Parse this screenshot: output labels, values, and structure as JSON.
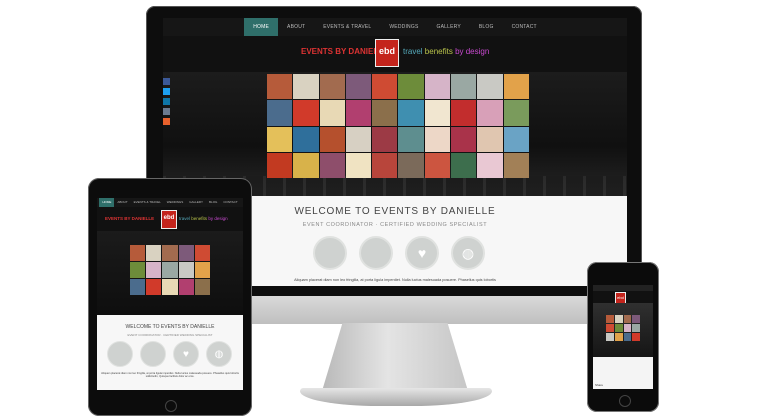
{
  "nav": {
    "items": [
      "HOME",
      "ABOUT",
      "EVENTS & TRAVEL",
      "WEDDINGS",
      "GALLERY",
      "BLOG",
      "CONTACT"
    ]
  },
  "logo": {
    "name": "EVENTS BY DANIELLE",
    "mark": "ebd",
    "tagline1": "travel",
    "tagline2": "benefits",
    "tagline3": "by design"
  },
  "welcome": {
    "title": "WELCOME TO EVENTS BY DANIELLE",
    "subtitle": "EVENT COORDINATOR · CERTIFIED WEDDING SPECIALIST",
    "body": "Aliquam placerat diam non leo fringilla, at porta ligula imperdiet. Nulla luctus malesuada posuere. Phasellus quis lobortis"
  },
  "tablet": {
    "body": "Aliquam placerat diam non leo fringilla, at porta ligula imperdiet. Nulla luctus malesuada posuere. Phasellus quis lobortis sollicitudin, Quisque facilisis dolor ac eros."
  },
  "phone": {
    "share": "Share"
  },
  "social_icons": [
    "facebook-icon",
    "twitter-icon",
    "linkedin-icon",
    "email-icon",
    "plus-icon"
  ],
  "colors": {
    "accent": "#2f6f6a",
    "logo_red": "#c4241c",
    "circle": "#cfd2d0"
  },
  "gallery_colors": [
    "#b65b3a",
    "#d9d2c1",
    "#a26b4f",
    "#7d5a7a",
    "#cf4b33",
    "#6d8c3a",
    "#d6b4c8",
    "#9aa8a3",
    "#c9c9c4",
    "#e2a24a",
    "#4b6c8d",
    "#d13a2a",
    "#e8d9b5",
    "#b13f6f",
    "#8b6f4b",
    "#3f8fb0",
    "#f1e6d0",
    "#c22d2d",
    "#d8a0b8",
    "#7a9b5c",
    "#e4c05a",
    "#2f6f9b",
    "#b5502d",
    "#d7d0c3",
    "#9c3a45",
    "#5e8e8f",
    "#edd7c7",
    "#a9334a",
    "#e0c6b0",
    "#6aa3c5",
    "#c23a21",
    "#d8b24a",
    "#8e4e6b",
    "#f0e3c2",
    "#b8453b",
    "#7b6a5a",
    "#cc5540",
    "#3d6e4d",
    "#e9c8d3",
    "#a28057"
  ]
}
